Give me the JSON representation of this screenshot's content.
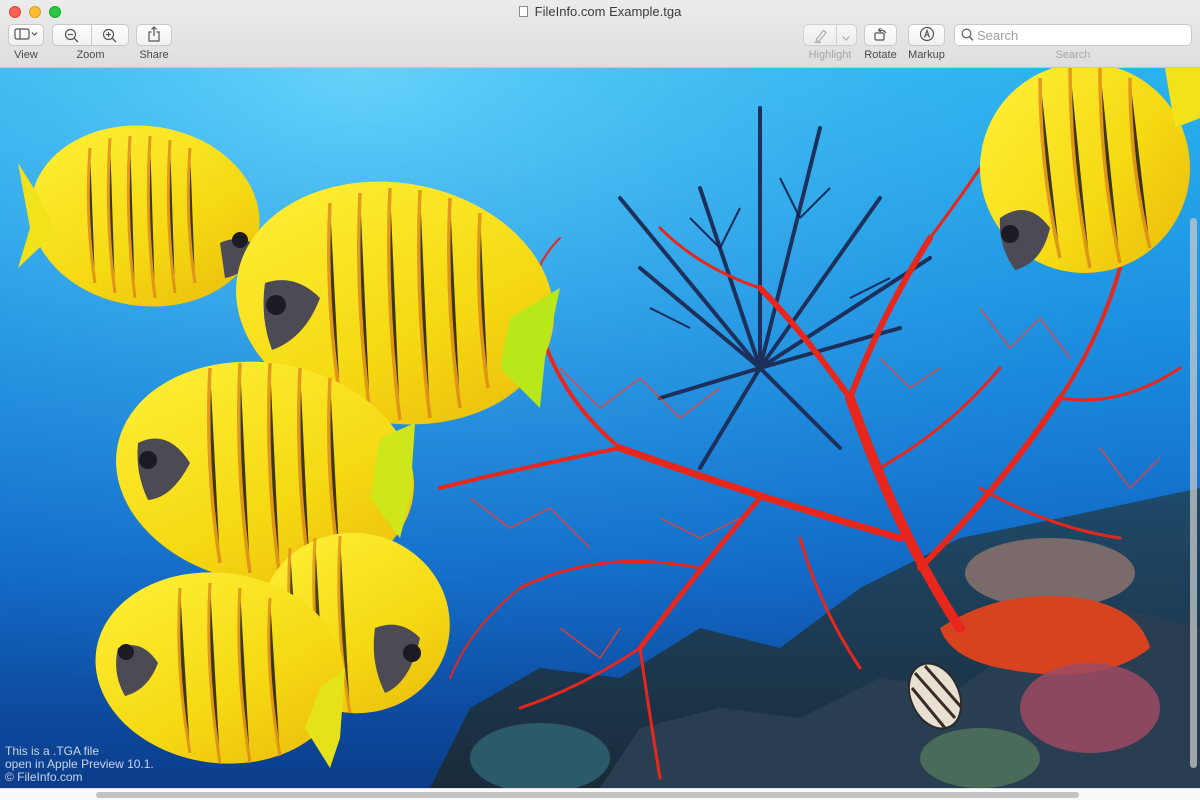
{
  "window": {
    "title": "FileInfo.com Example.tga"
  },
  "toolbar": {
    "view_label": "View",
    "zoom_label": "Zoom",
    "share_label": "Share",
    "highlight_label": "Highlight",
    "rotate_label": "Rotate",
    "markup_label": "Markup",
    "search_label": "Search",
    "search_placeholder": "Search"
  },
  "image": {
    "caption_line1": "This is a .TGA file",
    "caption_line2": "open in Apple Preview 10.1.",
    "caption_line3": "© FileInfo.com"
  },
  "colors": {
    "close": "#fe5f57",
    "minimize": "#febc2e",
    "maximize": "#28c840",
    "fish_yellow": "#f5e31c",
    "coral_red": "#e8261c"
  },
  "icons": {
    "view": "sidebar-icon",
    "zoom_out": "zoom-out-icon",
    "zoom_in": "zoom-in-icon",
    "share": "share-icon",
    "highlight": "highlighter-icon",
    "rotate": "rotate-icon",
    "markup": "markup-icon",
    "search": "magnifier-icon"
  }
}
